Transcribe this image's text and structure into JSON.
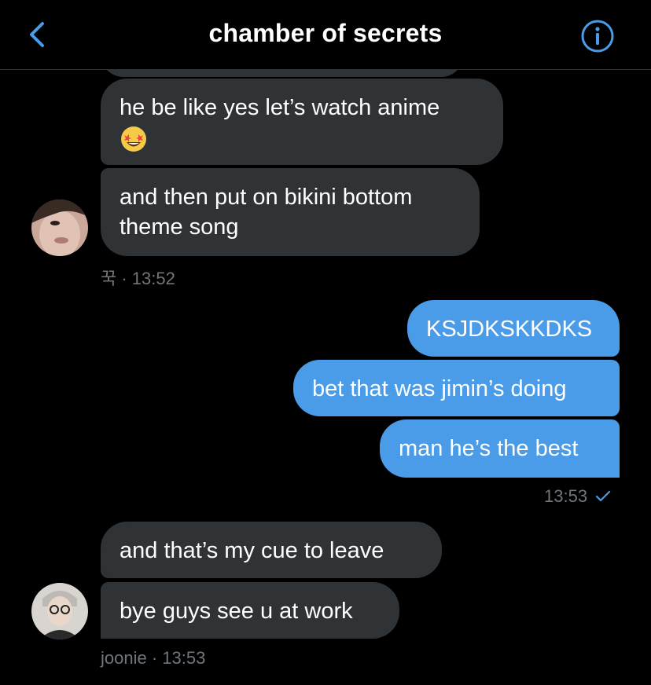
{
  "header": {
    "title": "chamber of secrets",
    "back_icon": "chevron-left-icon",
    "info_icon": "info-icon",
    "accent_color": "#4a9be8"
  },
  "messages": {
    "m1": {
      "text": "he be like yes let’s watch anime",
      "emoji": "star-struck-emoji"
    },
    "m2": {
      "text": "and then put on bikini bottom\ntheme song"
    },
    "m2_meta": "꾹 · 13:52",
    "m3": {
      "text": "KSJDKSKKDKS"
    },
    "m4": {
      "text": "bet that was jimin’s doing"
    },
    "m5": {
      "text": "man he’s the best"
    },
    "m5_meta": "13:53",
    "m6": {
      "text": "and that’s my cue to leave"
    },
    "m7": {
      "text": "bye guys see u at work"
    },
    "m7_meta": "joonie · 13:53"
  },
  "colors": {
    "incoming_bubble": "#2f3336",
    "outgoing_bubble": "#4a9be8",
    "meta_text": "#71767b",
    "background": "#000000"
  }
}
